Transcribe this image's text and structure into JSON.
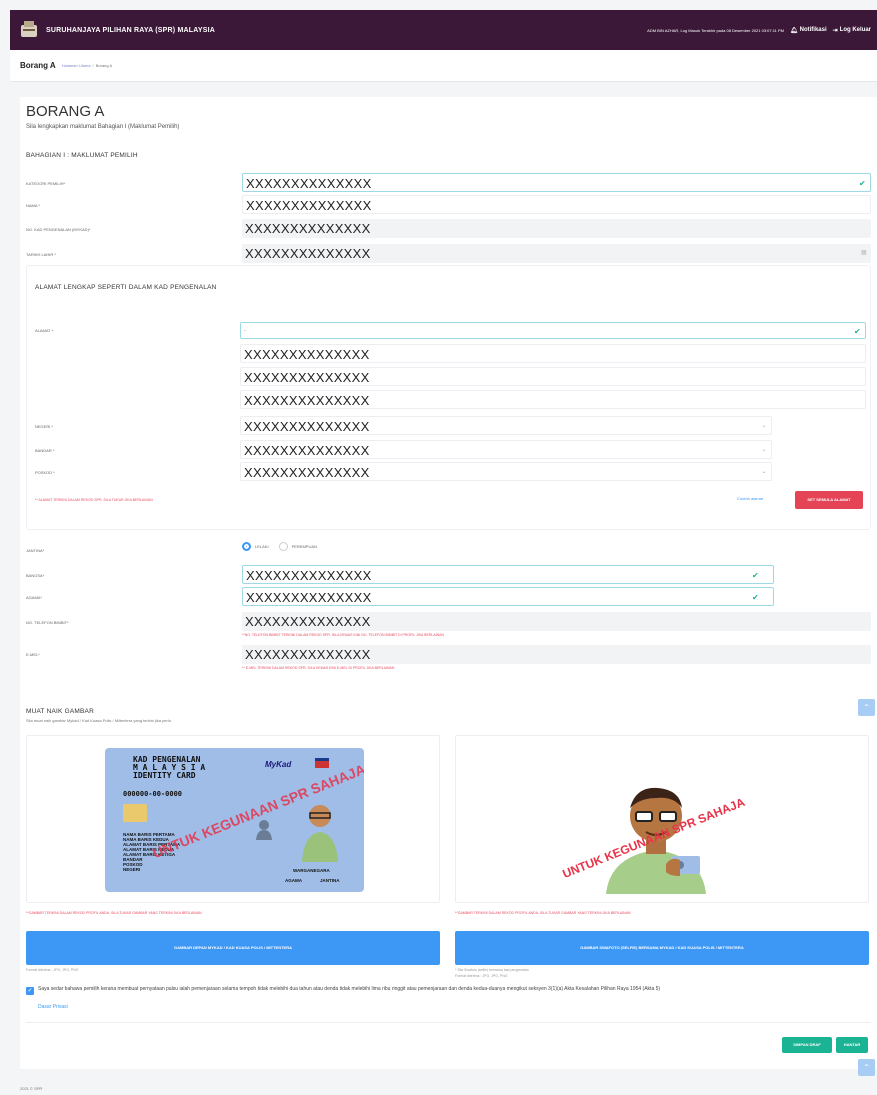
{
  "header": {
    "brand": "SURUHANJAYA PILIHAN RAYA (SPR) MALAYSIA",
    "last_login": "ADM BIN AZHAR, Log Masuk Terakhir pada 08 Desember 2021 03:07:11 PM",
    "notifications": "Notifikasi",
    "logout": "Log Keluar"
  },
  "breadcrumb": {
    "title": "Borang A",
    "home": "Halaman Utama",
    "sep": "/",
    "current": "Borang A"
  },
  "form": {
    "title": "BORANG A",
    "subtitle": "Sila lengkapkan maklumat Bahagian I (Maklumat Pemilih)",
    "section1": "BAHAGIAN I : MAKLUMAT PEMILIH",
    "fields": {
      "kategori_label": "KATEGORI PEMILIH*",
      "kategori_value": "XXXXXXXXXXXXXX",
      "nama_label": "NAMA *",
      "nama_value": "XXXXXXXXXXXXXX",
      "nokp_label": "NO. KAD PENGENALAN (MYKAD)*",
      "nokp_value": "XXXXXXXXXXXXXX",
      "tarikh_label": "TARIKH LAHIR *",
      "tarikh_value": "XXXXXXXXXXXXXX"
    },
    "address": {
      "heading": "ALAMAT LENGKAP SEPERTI DALAM KAD PENGENALAN",
      "alamat_label": "ALAMAT *",
      "alamat_value": "-",
      "line1": "XXXXXXXXXXXXXX",
      "line2": "XXXXXXXXXXXXXX",
      "line3": "XXXXXXXXXXXXXX",
      "negeri_label": "NEGERI *",
      "negeri_value": "XXXXXXXXXXXXXX",
      "bandar_label": "BANDAR *",
      "bandar_value": "XXXXXXXXXXXXXX",
      "poskod_label": "POSKOD *",
      "poskod_value": "XXXXXXXXXXXXXX",
      "note": "** ALAMAT TERKINI DALAM REKOD SPR. SILA TUKAR JIKA BERLAINAN",
      "example_link": "Contoh alamat",
      "reset_button": "SET SEMULA ALAMAT"
    },
    "jantina_label": "JANTINA*",
    "gender": {
      "male": "LELAKI",
      "female": "PEREMPUAN",
      "selected": "male"
    },
    "bangsa_label": "BANGSA*",
    "bangsa_value": "XXXXXXXXXXXXXX",
    "agama_label": "AGAMA*",
    "agama_value": "XXXXXXXXXXXXXX",
    "phone_label": "NO. TELEFON BIMBIT*",
    "phone_value": "XXXXXXXXXXXXXX",
    "phone_note": "**NO. TELEFON BIMBIT TERKINI DALAM REKOD SPR. SILA KEMAS KINI NO. TELEFON BIMBIT DI PROFIL JIKA BERLAINAN",
    "email_label": "E-MEL*",
    "email_value": "XXXXXXXXXXXXXX",
    "email_note": "** E-MEL TERKINI DALAM REKOD SPR. SILA KEMAS KINI E-MEL DI PROFIL JIKA BERLAINAN"
  },
  "upload": {
    "heading": "MUAT NAIK GAMBAR",
    "subtitle": "Sila muat naik gambar Mykad / Kad Kuasa Polis / Miltentera yang terkini jika perlu",
    "card": {
      "title1": "KAD PENGENALAN",
      "title2": "M A L A Y S I A",
      "title3": "IDENTITY CARD",
      "mykad": "MyKad",
      "number": "000000-00-0000",
      "lines": [
        "NAMA BARIS PERTAMA",
        "NAMA BARIS KEDUA",
        "ALAMAT BARIS PERTAMA",
        "ALAMAT BARIS KEDUA",
        "ALAMAT BARIS KETIGA",
        "BANDAR",
        "POSKOD",
        "NEGERI"
      ],
      "warganegara": "WARGANEGARA",
      "agama": "AGAMA",
      "jantina": "JANTINA",
      "watermark": "UNTUK KEGUNAAN SPR SAHAJA"
    },
    "selfie_watermark": "UNTUK KEGUNAAN SPR SAHAJA",
    "left_note": "**GAMBAR TERKINI DALAM REKOD PROFIL ANDA. SILA TUKAR GAMBAR YANG TERKINI JIKA BERLAINAN",
    "right_note": "**GAMBAR TERKINI DALAM REKOD PROFIL ANDA. SILA TUKAR GAMBAR YANG TERKINI JIKA BERLAINAN",
    "left_button": "GAMBAR DEPAN MYKAD / KAD KUASA POLIS / MITTENTERA",
    "right_button": "GAMBAR SWAFOTO (SELFIE) BERSAMA MYKAD / KAD KUASA POLIS / MITTENTERA",
    "left_format": "Format diterima : JPG, JPG, PNG",
    "right_help1": "* Sila Swafoto (selfie) bersama kad pengenalan",
    "right_format": "Format diterima : JPG, JPG, PNG"
  },
  "declaration": {
    "text": "Saya sedar bahawa pemilih kerana membuat pernyataan palsu ialah pemenjaraan selama tempoh tidak melebihi dua tahun atau denda tidak melebihi lima ribu ringgit atau pemenjaraan dan denda kedua-duanya mengikut seksyen 3(1)(a) Akta Kesalahan Pilihan Raya 1954 (Akta 5)",
    "privacy_link": "Dasar Privasi"
  },
  "actions": {
    "draft": "SIMPAN DRAF",
    "submit": "HANTAR"
  },
  "footer": "2021 © SPR"
}
